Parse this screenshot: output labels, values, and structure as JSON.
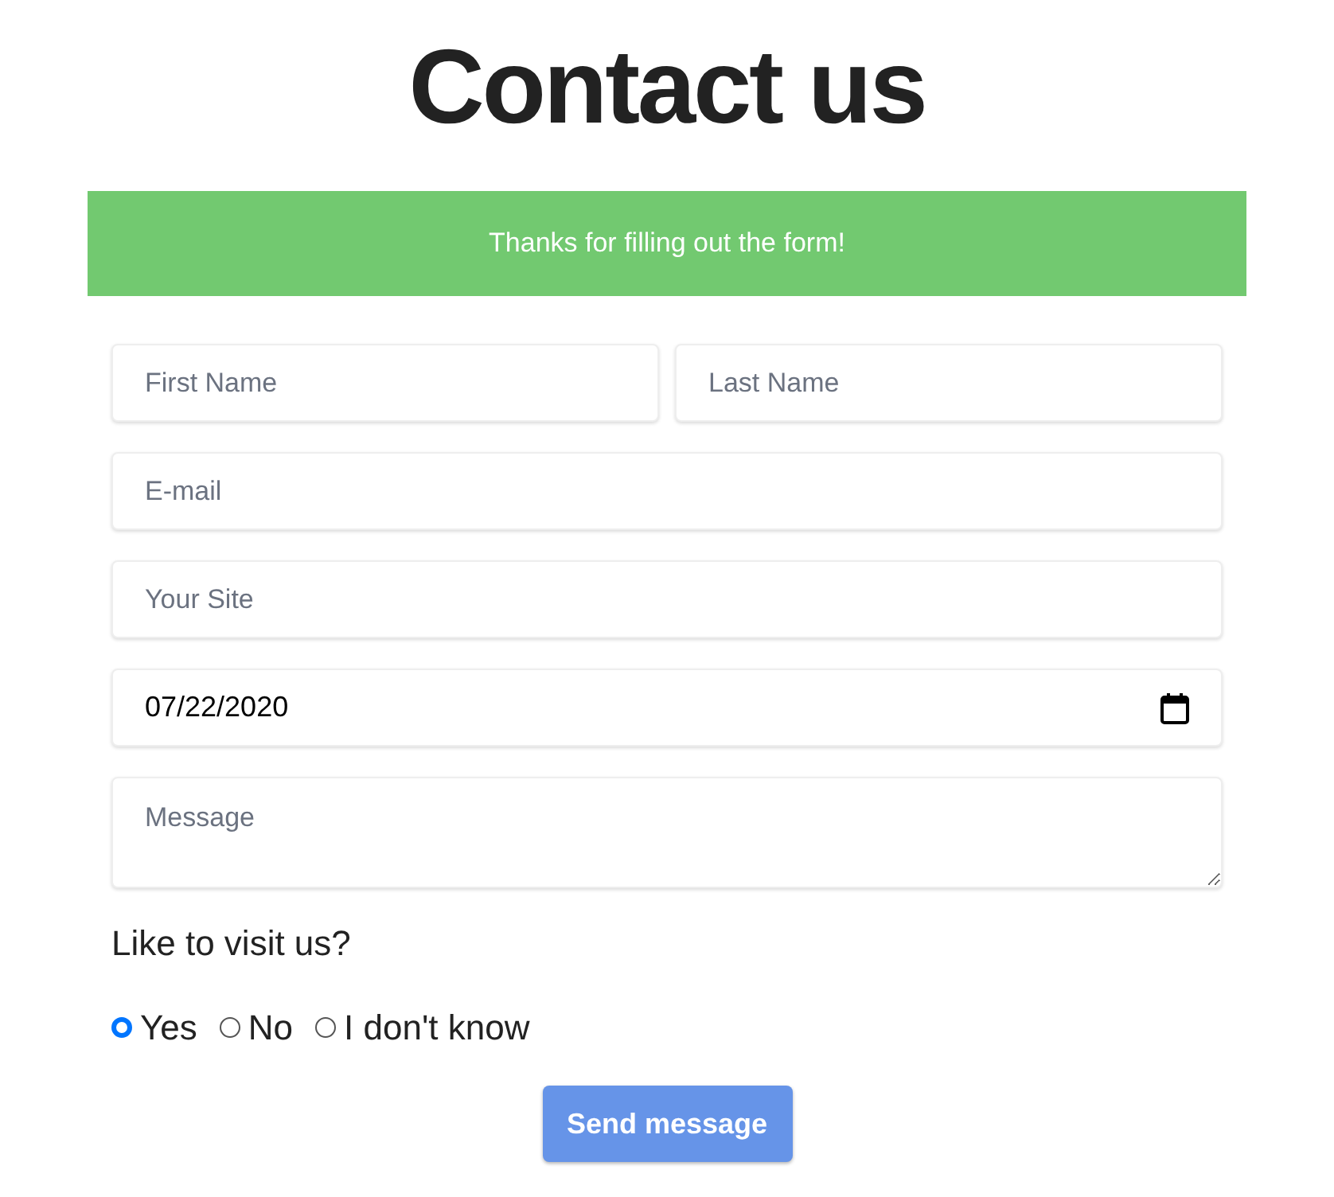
{
  "title": "Contact us",
  "alert": {
    "text": "Thanks for filling out the form!"
  },
  "name_fields": [
    {
      "placeholder": "First Name"
    },
    {
      "placeholder": "Last Name"
    }
  ],
  "fields": [
    {
      "kind": "text",
      "placeholder": "E-mail"
    },
    {
      "kind": "text",
      "placeholder": "Your Site"
    },
    {
      "kind": "date",
      "value": "07/22/2020"
    },
    {
      "kind": "textarea",
      "placeholder": "Message"
    }
  ],
  "question": "Like to visit us?",
  "options": [
    {
      "label": "Yes",
      "selected": true
    },
    {
      "label": "No",
      "selected": false
    },
    {
      "label": "I don't know",
      "selected": false
    }
  ],
  "submit": "Send message"
}
